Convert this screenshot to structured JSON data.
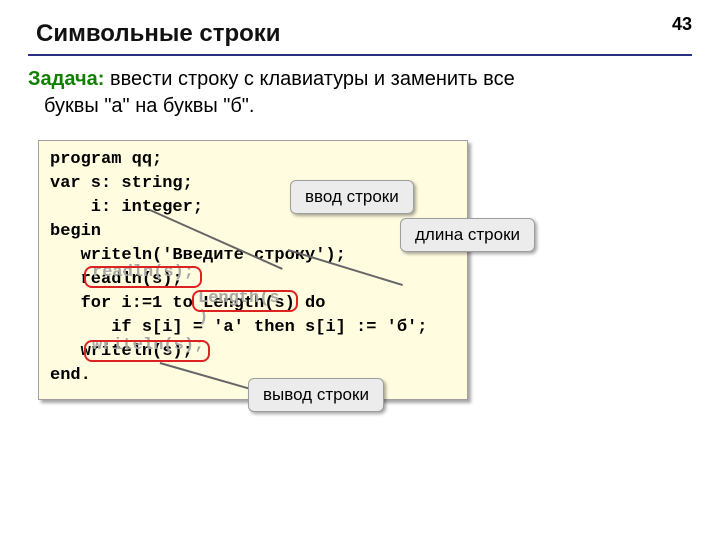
{
  "page_number": "43",
  "title": "Символьные строки",
  "task": {
    "label": "Задача:",
    "line1": "ввести строку с клавиатуры и заменить все",
    "line2": "буквы \"а\" на буквы \"б\"."
  },
  "code": {
    "l1": "program qq;",
    "l2": "var s: string;",
    "l3": "    i: integer;",
    "l4": "begin",
    "l5": "   writeln('Введите строку');",
    "l6": "   readln(s);",
    "l7": "   for i:=1 to Length(s) do",
    "l8": "      if s[i] = 'а' then s[i] := 'б';",
    "l9": "   writeln(s);",
    "l10": "end."
  },
  "ghost": {
    "readln": "readln(s);",
    "length": "Length(s\n)",
    "writeln": "writeln(s);"
  },
  "callouts": {
    "input": "ввод строки",
    "length": "длина строки",
    "output": "вывод строки"
  }
}
